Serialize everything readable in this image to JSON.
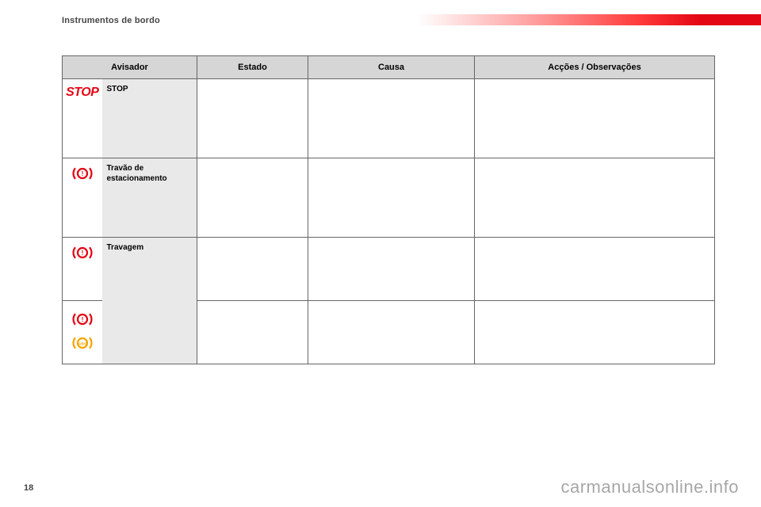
{
  "section_title": "Instrumentos de bordo",
  "page_number": "18",
  "watermark": "carmanualsonline.info",
  "headers": {
    "avisador": "Avisador",
    "estado": "Estado",
    "causa": "Causa",
    "accoes": "Acções / Observações"
  },
  "rows": [
    {
      "icon": "stop",
      "icon_label": "STOP",
      "name": "STOP",
      "estado": "",
      "causa": "",
      "accoes": ""
    },
    {
      "icon": "brake-red",
      "name": "Travão de estacionamento",
      "estado": "",
      "causa": "",
      "accoes": ""
    },
    {
      "icon": "brake-red",
      "name": "Travagem",
      "name_rowspan": 2,
      "estado": "",
      "causa": "",
      "accoes": ""
    },
    {
      "icon": "brake-red+abs-amber",
      "estado": "",
      "causa": "",
      "accoes": ""
    }
  ]
}
